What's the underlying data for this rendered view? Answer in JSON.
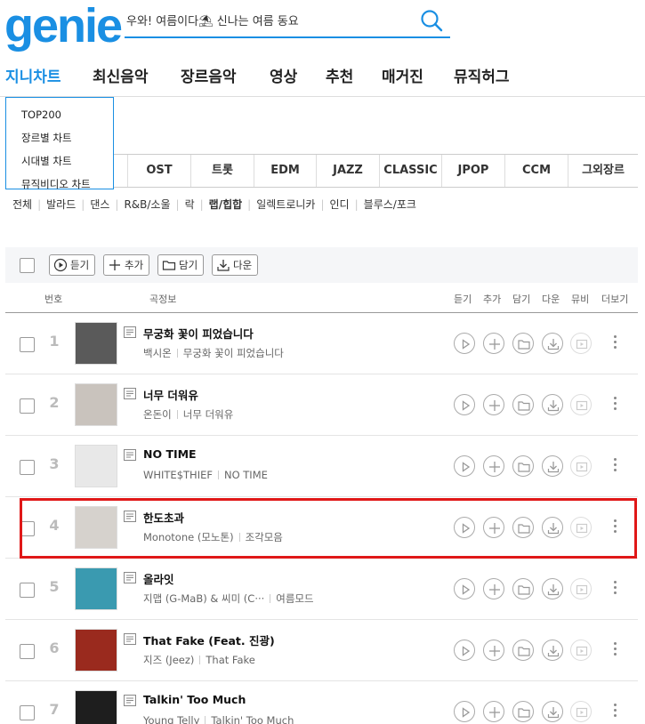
{
  "header": {
    "logo": "genie",
    "search_placeholder": "우와! 여름이다⛱ 신나는 여름 동요"
  },
  "nav": {
    "items": [
      "지니차트",
      "최신음악",
      "장르음악",
      "영상",
      "추천",
      "매거진",
      "뮤직허그"
    ],
    "active": "지니차트"
  },
  "dropdown": {
    "items": [
      "TOP200",
      "장르별 차트",
      "시대별 차트",
      "뮤직비디오 차트"
    ]
  },
  "genre_tabs": [
    "OST",
    "트롯",
    "EDM",
    "JAZZ",
    "CLASSIC",
    "JPOP",
    "CCM",
    "그외장르"
  ],
  "subgenres": [
    "전체",
    "발라드",
    "댄스",
    "R&B/소울",
    "락",
    "랩/힙합",
    "일렉트로니카",
    "인디",
    "블루스/포크"
  ],
  "subgenre_selected": "랩/힙합",
  "toolbar": {
    "listen": "듣기",
    "add": "추가",
    "save": "담기",
    "download": "다운"
  },
  "list_header": {
    "number": "번호",
    "song_info": "곡정보",
    "listen": "듣기",
    "add": "추가",
    "save": "담기",
    "download": "다운",
    "mv": "뮤비",
    "more": "더보기"
  },
  "songs": [
    {
      "rank": "1",
      "title": "무궁화 꽃이 피었습니다",
      "artist": "백시온",
      "album": "무궁화 꽃이 피었습니다",
      "cover_color": "#5a5a5a"
    },
    {
      "rank": "2",
      "title": "너무 더워유",
      "artist": "온돈이",
      "album": "너무 더워유",
      "cover_color": "#c9c3bd"
    },
    {
      "rank": "3",
      "title": "NO TIME",
      "artist": "WHITE$THIEF",
      "album": "NO TIME",
      "cover_color": "#e8e8e8"
    },
    {
      "rank": "4",
      "title": "한도초과",
      "artist": "Monotone (모노톤)",
      "album": "조각모음",
      "cover_color": "#d6d2cd"
    },
    {
      "rank": "5",
      "title": "올라잇",
      "artist": "지맵 (G-MaB) & 씨미 (C···",
      "album": "여름모드",
      "cover_color": "#3a9ab0"
    },
    {
      "rank": "6",
      "title": "That Fake (Feat. 진광)",
      "artist": "지즈 (Jeez)",
      "album": "That Fake",
      "cover_color": "#9a2a1e"
    },
    {
      "rank": "7",
      "title": "Talkin' Too Much",
      "artist": "Young Telly",
      "album": "Talkin' Too Much",
      "cover_color": "#1e1e1e"
    }
  ],
  "colors": {
    "brand": "#1a8fe3",
    "highlight": "#e01818"
  }
}
